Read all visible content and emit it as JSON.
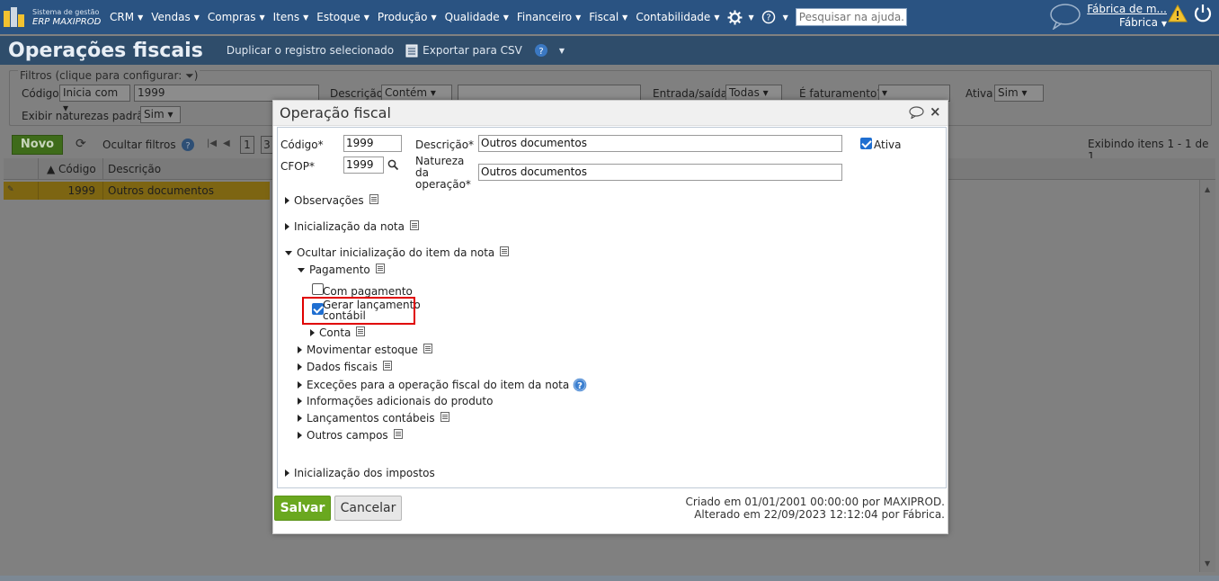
{
  "topbar": {
    "logo_line1": "Sistema de gestão",
    "logo_line2": "ERP MAXIPROD",
    "menus": [
      "CRM",
      "Vendas",
      "Compras",
      "Itens",
      "Estoque",
      "Produção",
      "Qualidade",
      "Financeiro",
      "Fiscal",
      "Contabilidade"
    ],
    "search_placeholder": "Pesquisar na ajuda...",
    "company_link": "Fábrica de m...",
    "user_role": "Fábrica"
  },
  "page": {
    "title": "Operações fiscais",
    "action_duplicate": "Duplicar o registro selecionado",
    "action_export": "Exportar para CSV"
  },
  "filters": {
    "legend": "Filtros (clique para configurar:",
    "legend_end": ")",
    "codigo_label": "Código",
    "codigo_op": "Inicia com",
    "codigo_value": "1999",
    "descricao_label": "Descrição",
    "descricao_op": "Contém",
    "entrada_label": "Entrada/saída",
    "entrada_value": "Todas",
    "faturamento_label": "É faturamento?",
    "ativa_label": "Ativa",
    "ativa_value": "Sim",
    "naturezas_label": "Exibir naturezas padrão",
    "naturezas_value": "Sim"
  },
  "listing": {
    "new_button": "Novo",
    "hide_filters": "Ocultar filtros",
    "page_number": "1",
    "page_number_2": "3",
    "display_info": "Exibindo itens 1 - 1 de 1",
    "col_codigo": "Código",
    "col_descricao": "Descrição",
    "rows": [
      {
        "codigo": "1999",
        "descricao": "Outros documentos"
      }
    ]
  },
  "modal": {
    "title": "Operação fiscal",
    "codigo_label": "Código*",
    "codigo_value": "1999",
    "descricao_label": "Descrição*",
    "descricao_value": "Outros documentos",
    "ativa_label": "Ativa",
    "cfop_label": "CFOP*",
    "cfop_value": "1999",
    "natureza_label_1": "Natureza",
    "natureza_label_2": "da",
    "natureza_label_3": "operação*",
    "natureza_value": "Outros documentos",
    "sections": {
      "observacoes": "Observações",
      "inicializacao_nota": "Inicialização da nota",
      "ocultar_item": "Ocultar inicialização do item da nota",
      "pagamento": "Pagamento",
      "com_pagamento": "Com pagamento",
      "gerar_1": "Gerar lançamento",
      "gerar_2": "contábil",
      "conta": "Conta",
      "movimentar": "Movimentar estoque",
      "dados_fiscais": "Dados fiscais",
      "excecoes": "Exceções para a operação fiscal do item da nota",
      "info_adicionais": "Informações adicionais do produto",
      "lancamentos": "Lançamentos contábeis",
      "outros_campos": "Outros campos",
      "inicializacao_impostos": "Inicialização dos impostos"
    },
    "save_button": "Salvar",
    "cancel_button": "Cancelar",
    "created": "Criado em 01/01/2001 00:00:00 por MAXIPROD.",
    "updated": "Alterado em 22/09/2023 12:12:04 por Fábrica."
  },
  "colors": {
    "topbar": "#2a5382",
    "titlebar": "#2f4d6b",
    "save_green": "#6aa81f",
    "highlight_red": "#e00000",
    "checkbox_blue": "#1f6fd1"
  }
}
